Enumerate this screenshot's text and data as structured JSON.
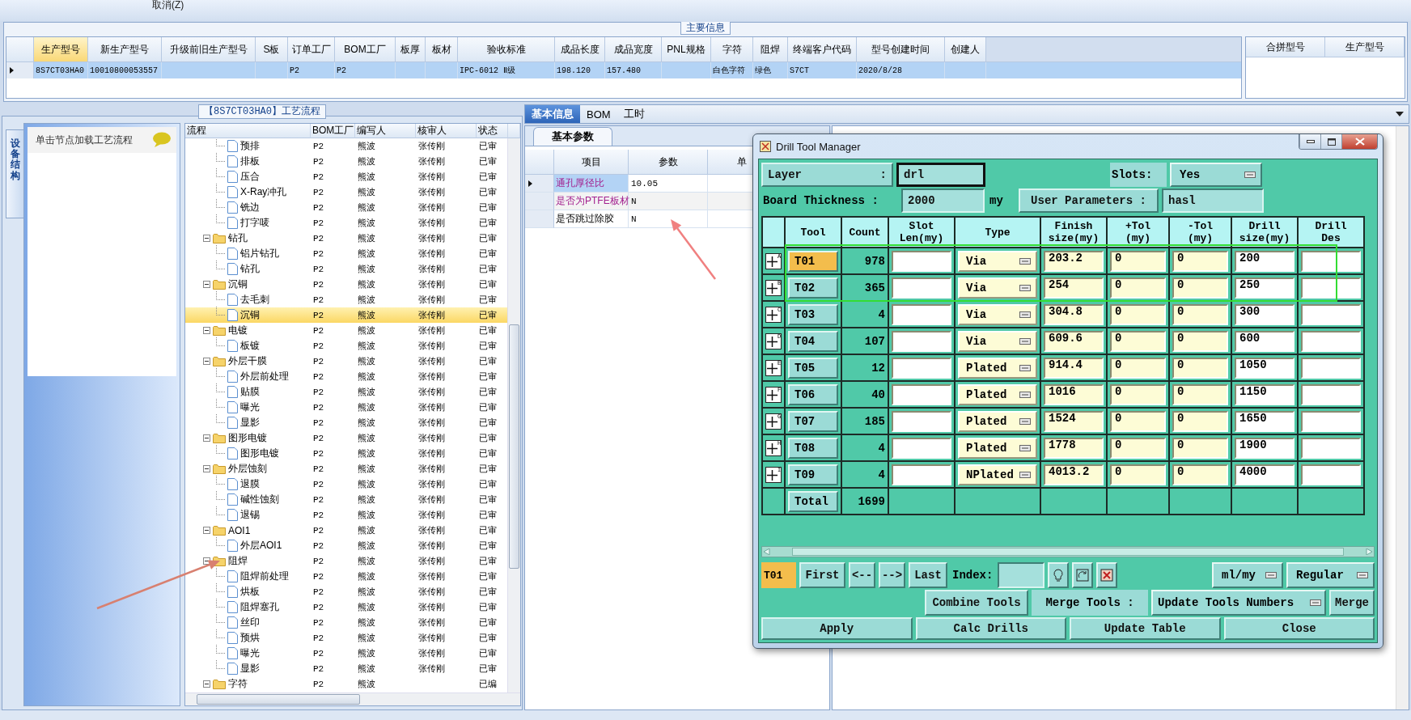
{
  "toolbar": {
    "items": [
      "取消(Z)"
    ]
  },
  "main_info": {
    "title": "主要信息",
    "columns": [
      {
        "label": "生产型号",
        "selected": true
      },
      {
        "label": "新生产型号",
        "selected": false
      },
      {
        "label": "升级前旧生产型号",
        "selected": false
      },
      {
        "label": "S板",
        "selected": false
      },
      {
        "label": "订单工厂",
        "selected": false
      },
      {
        "label": "BOM工厂",
        "selected": false
      },
      {
        "label": "板厚",
        "selected": false
      },
      {
        "label": "板材",
        "selected": false
      },
      {
        "label": "验收标准",
        "selected": false
      },
      {
        "label": "成品长度",
        "selected": false
      },
      {
        "label": "成品宽度",
        "selected": false
      },
      {
        "label": "PNL规格",
        "selected": false
      },
      {
        "label": "字符",
        "selected": false
      },
      {
        "label": "阻焊",
        "selected": false
      },
      {
        "label": "终端客户代码",
        "selected": false
      },
      {
        "label": "型号创建时间",
        "selected": false
      },
      {
        "label": "创建人",
        "selected": false
      }
    ],
    "rows": [
      {
        "selected": true,
        "cells": [
          "8S7CT03HA0",
          "10010800053557",
          null,
          null,
          "P2",
          "P2",
          null,
          null,
          "IPC-6012 Ⅱ级",
          "198.120",
          "157.480",
          null,
          "白色字符",
          "绿色",
          "S7CT",
          "2020/8/28",
          null
        ]
      }
    ],
    "side_columns": [
      "合拼型号",
      "生产型号"
    ]
  },
  "process": {
    "title": "【8S7CT03HA0】工艺流程",
    "side_tab": "设备结构",
    "hint": "单击节点加载工艺流程",
    "columns": [
      "流程",
      "BOM工厂",
      "编写人",
      "核审人",
      "状态"
    ],
    "tree": [
      {
        "children": [
          {
            "label": "预排",
            "bom": "P2",
            "author": "熊波",
            "reviewer": "张传刚",
            "status": "已审",
            "selected": false
          },
          {
            "label": "排板",
            "bom": "P2",
            "author": "熊波",
            "reviewer": "张传刚",
            "status": "已审",
            "selected": false
          },
          {
            "label": "压合",
            "bom": "P2",
            "author": "熊波",
            "reviewer": "张传刚",
            "status": "已审",
            "selected": false
          },
          {
            "label": "X-Ray冲孔",
            "bom": "P2",
            "author": "熊波",
            "reviewer": "张传刚",
            "status": "已审",
            "selected": false
          },
          {
            "label": "铣边",
            "bom": "P2",
            "author": "熊波",
            "reviewer": "张传刚",
            "status": "已审",
            "selected": false
          },
          {
            "label": "打字唛",
            "bom": "P2",
            "author": "熊波",
            "reviewer": "张传刚",
            "status": "已审",
            "selected": false
          }
        ]
      },
      {
        "label": "钻孔",
        "bom": "P2",
        "author": "熊波",
        "reviewer": "张传刚",
        "status": "已审",
        "selected": false,
        "expanded": true,
        "children": [
          {
            "label": "铝片钻孔",
            "bom": "P2",
            "author": "熊波",
            "reviewer": "张传刚",
            "status": "已审",
            "selected": false
          },
          {
            "label": "钻孔",
            "bom": "P2",
            "author": "熊波",
            "reviewer": "张传刚",
            "status": "已审",
            "selected": false
          }
        ]
      },
      {
        "label": "沉铜",
        "bom": "P2",
        "author": "熊波",
        "reviewer": "张传刚",
        "status": "已审",
        "selected": false,
        "expanded": true,
        "children": [
          {
            "label": "去毛刺",
            "bom": "P2",
            "author": "熊波",
            "reviewer": "张传刚",
            "status": "已审",
            "selected": false
          },
          {
            "label": "沉铜",
            "bom": "P2",
            "author": "熊波",
            "reviewer": "张传刚",
            "status": "已审",
            "selected": true
          }
        ]
      },
      {
        "label": "电镀",
        "bom": "P2",
        "author": "熊波",
        "reviewer": "张传刚",
        "status": "已审",
        "selected": false,
        "expanded": true,
        "children": [
          {
            "label": "板镀",
            "bom": "P2",
            "author": "熊波",
            "reviewer": "张传刚",
            "status": "已审",
            "selected": false
          }
        ]
      },
      {
        "label": "外层干膜",
        "bom": "P2",
        "author": "熊波",
        "reviewer": "张传刚",
        "status": "已审",
        "selected": false,
        "expanded": true,
        "children": [
          {
            "label": "外层前处理",
            "bom": "P2",
            "author": "熊波",
            "reviewer": "张传刚",
            "status": "已审",
            "selected": false
          },
          {
            "label": "贴膜",
            "bom": "P2",
            "author": "熊波",
            "reviewer": "张传刚",
            "status": "已审",
            "selected": false
          },
          {
            "label": "曝光",
            "bom": "P2",
            "author": "熊波",
            "reviewer": "张传刚",
            "status": "已审",
            "selected": false
          },
          {
            "label": "显影",
            "bom": "P2",
            "author": "熊波",
            "reviewer": "张传刚",
            "status": "已审",
            "selected": false
          }
        ]
      },
      {
        "label": "图形电镀",
        "bom": "P2",
        "author": "熊波",
        "reviewer": "张传刚",
        "status": "已审",
        "selected": false,
        "expanded": true,
        "children": [
          {
            "label": "图形电镀",
            "bom": "P2",
            "author": "熊波",
            "reviewer": "张传刚",
            "status": "已审",
            "selected": false
          }
        ]
      },
      {
        "label": "外层蚀刻",
        "bom": "P2",
        "author": "熊波",
        "reviewer": "张传刚",
        "status": "已审",
        "selected": false,
        "expanded": true,
        "children": [
          {
            "label": "退膜",
            "bom": "P2",
            "author": "熊波",
            "reviewer": "张传刚",
            "status": "已审",
            "selected": false
          },
          {
            "label": "碱性蚀刻",
            "bom": "P2",
            "author": "熊波",
            "reviewer": "张传刚",
            "status": "已审",
            "selected": false
          },
          {
            "label": "退锡",
            "bom": "P2",
            "author": "熊波",
            "reviewer": "张传刚",
            "status": "已审",
            "selected": false
          }
        ]
      },
      {
        "label": "AOI1",
        "bom": "P2",
        "author": "熊波",
        "reviewer": "张传刚",
        "status": "已审",
        "selected": false,
        "expanded": true,
        "children": [
          {
            "label": "外层AOI1",
            "bom": "P2",
            "author": "熊波",
            "reviewer": "张传刚",
            "status": "已审",
            "selected": false
          }
        ]
      },
      {
        "label": "阻焊",
        "bom": "P2",
        "author": "熊波",
        "reviewer": "张传刚",
        "status": "已审",
        "selected": false,
        "expanded": true,
        "children": [
          {
            "label": "阻焊前处理",
            "bom": "P2",
            "author": "熊波",
            "reviewer": "张传刚",
            "status": "已审",
            "selected": false
          },
          {
            "label": "烘板",
            "bom": "P2",
            "author": "熊波",
            "reviewer": "张传刚",
            "status": "已审",
            "selected": false
          },
          {
            "label": "阻焊塞孔",
            "bom": "P2",
            "author": "熊波",
            "reviewer": "张传刚",
            "status": "已审",
            "selected": false
          },
          {
            "label": "丝印",
            "bom": "P2",
            "author": "熊波",
            "reviewer": "张传刚",
            "status": "已审",
            "selected": false
          },
          {
            "label": "预烘",
            "bom": "P2",
            "author": "熊波",
            "reviewer": "张传刚",
            "status": "已审",
            "selected": false
          },
          {
            "label": "曝光",
            "bom": "P2",
            "author": "熊波",
            "reviewer": "张传刚",
            "status": "已审",
            "selected": false
          },
          {
            "label": "显影",
            "bom": "P2",
            "author": "熊波",
            "reviewer": "张传刚",
            "status": "已审",
            "selected": false
          }
        ]
      },
      {
        "label": "字符",
        "bom": "P2",
        "author": "熊波",
        "status": "已编",
        "selected": false,
        "expanded": true
      }
    ]
  },
  "detail": {
    "tabs": [
      {
        "label": "基本信息",
        "selected": true
      },
      {
        "label": "BOM",
        "selected": false
      },
      {
        "label": "工时",
        "selected": false
      }
    ],
    "subtabs": [
      {
        "label": "基本参数",
        "selected": true
      }
    ],
    "columns": [
      "项目",
      "参数",
      "单"
    ],
    "rows": [
      {
        "label": "通孔厚径比",
        "value": "10.05",
        "highlighted": true,
        "selected": true
      },
      {
        "label": "是否为PTFE板材",
        "value": "N",
        "highlighted": true,
        "selected": false
      },
      {
        "label": "是否跳过除胶",
        "value": "N",
        "highlighted": false,
        "selected": false
      }
    ]
  },
  "dialog": {
    "title": "Drill Tool Manager",
    "layer_label": "Layer",
    "layer_colon": ":",
    "layer": "drl",
    "slots_label": "Slots:",
    "slots": "Yes",
    "thickness_label": "Board Thickness :",
    "thickness": "2000",
    "thickness_unit": "my",
    "user_params_label": "User Parameters :",
    "user_params": "hasl",
    "columns": [
      "Tool",
      "Count",
      "Slot\nLen(my)",
      "Type",
      "Finish\nsize(my)",
      "+Tol\n(my)",
      "-Tol\n(my)",
      "Drill\nsize(my)",
      "Drill\nDes"
    ],
    "tools": [
      {
        "marker": "A",
        "tool": "T01",
        "count": "978",
        "type": "Via",
        "finish": "203.2",
        "plus_tol": "0",
        "minus_tol": "0",
        "drill_size": "200",
        "selected": true
      },
      {
        "marker": "B",
        "tool": "T02",
        "count": "365",
        "type": "Via",
        "finish": "254",
        "plus_tol": "0",
        "minus_tol": "0",
        "drill_size": "250",
        "selected": false
      },
      {
        "marker": "C",
        "tool": "T03",
        "count": "4",
        "type": "Via",
        "finish": "304.8",
        "plus_tol": "0",
        "minus_tol": "0",
        "drill_size": "300",
        "selected": false
      },
      {
        "marker": "D",
        "tool": "T04",
        "count": "107",
        "type": "Via",
        "finish": "609.6",
        "plus_tol": "0",
        "minus_tol": "0",
        "drill_size": "600",
        "selected": false
      },
      {
        "marker": "E",
        "tool": "T05",
        "count": "12",
        "type": "Plated",
        "finish": "914.4",
        "plus_tol": "0",
        "minus_tol": "0",
        "drill_size": "1050",
        "selected": false
      },
      {
        "marker": "F",
        "tool": "T06",
        "count": "40",
        "type": "Plated",
        "finish": "1016",
        "plus_tol": "0",
        "minus_tol": "0",
        "drill_size": "1150",
        "selected": false
      },
      {
        "marker": "G",
        "tool": "T07",
        "count": "185",
        "type": "Plated",
        "finish": "1524",
        "plus_tol": "0",
        "minus_tol": "0",
        "drill_size": "1650",
        "selected": false
      },
      {
        "marker": "H",
        "tool": "T08",
        "count": "4",
        "type": "Plated",
        "finish": "1778",
        "plus_tol": "0",
        "minus_tol": "0",
        "drill_size": "1900",
        "selected": false
      },
      {
        "marker": "I",
        "tool": "T09",
        "count": "4",
        "type": "NPlated",
        "finish": "4013.2",
        "plus_tol": "0",
        "minus_tol": "0",
        "drill_size": "4000",
        "selected": false
      }
    ],
    "total_label": "Total",
    "total": "1699",
    "current": "T01",
    "nav": [
      "First",
      "<--",
      "-->",
      "Last"
    ],
    "index_label": "Index:",
    "units": "ml/my",
    "mode": "Regular",
    "combine": "Combine Tools",
    "merge_label": "Merge Tools :",
    "merge_mode": "Update Tools Numbers",
    "merge": "Merge",
    "actions": [
      "Apply",
      "Calc Drills",
      "Update Table",
      "Close"
    ]
  }
}
